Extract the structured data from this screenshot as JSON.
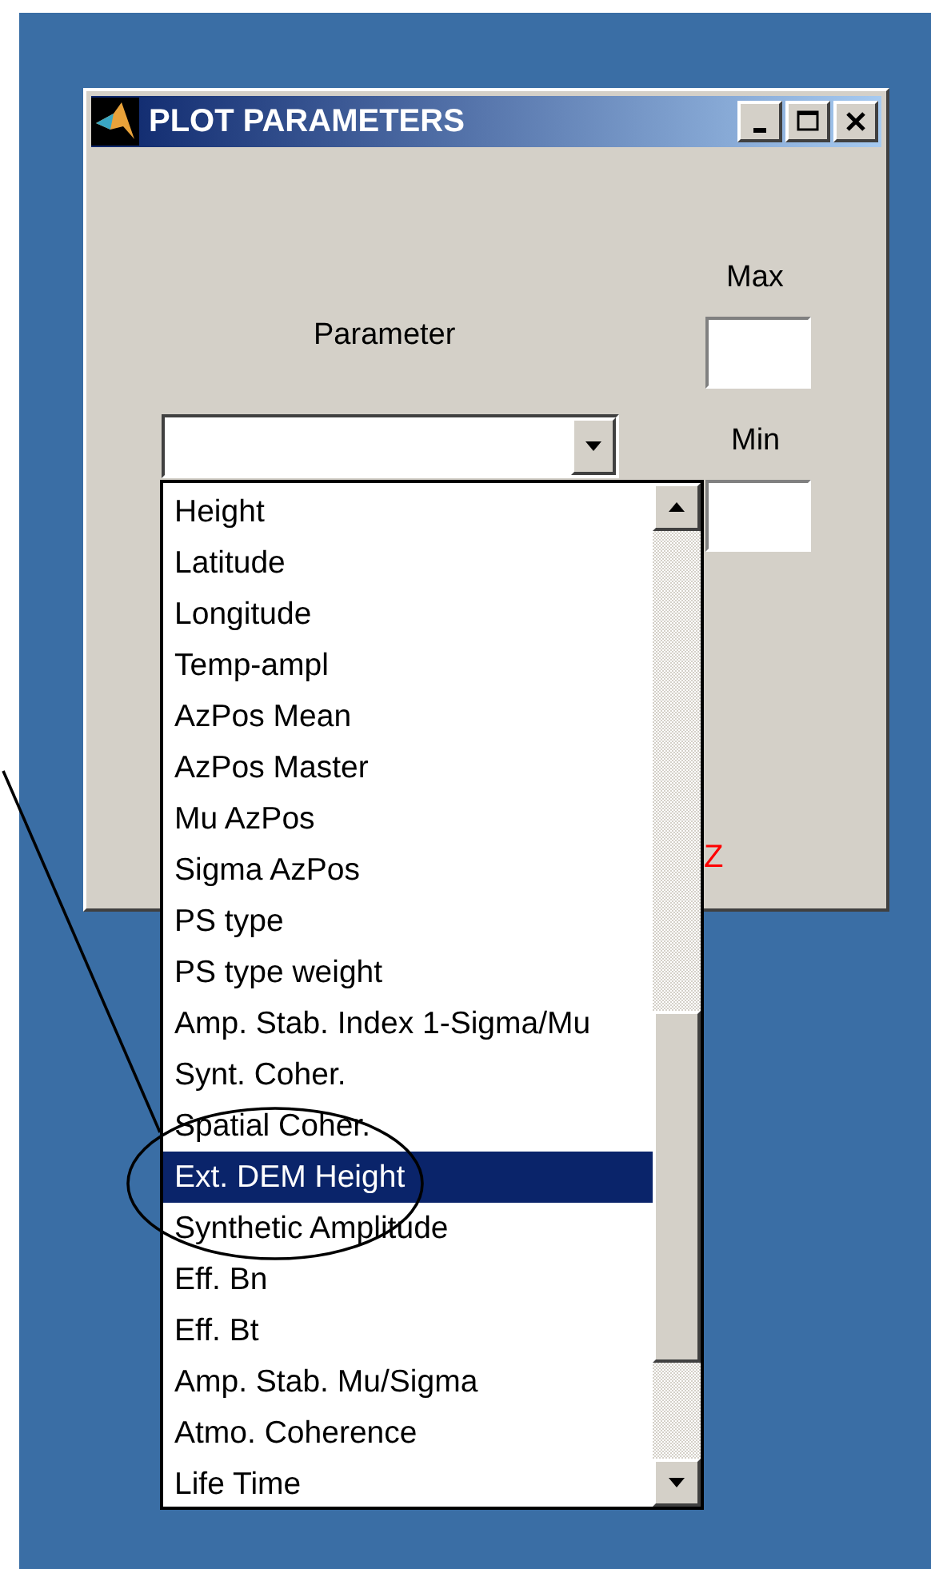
{
  "window": {
    "title": "PLOT PARAMETERS"
  },
  "parameter_label": "Parameter",
  "max_label": "Max",
  "min_label": "Min",
  "partial_label": "Z",
  "dropdown": {
    "items": [
      {
        "label": "Height",
        "selected": false
      },
      {
        "label": "Latitude",
        "selected": false
      },
      {
        "label": "Longitude",
        "selected": false
      },
      {
        "label": "Temp-ampl",
        "selected": false
      },
      {
        "label": "AzPos Mean",
        "selected": false
      },
      {
        "label": "AzPos Master",
        "selected": false
      },
      {
        "label": "Mu AzPos",
        "selected": false
      },
      {
        "label": "Sigma AzPos",
        "selected": false
      },
      {
        "label": "PS type",
        "selected": false
      },
      {
        "label": "PS type weight",
        "selected": false
      },
      {
        "label": "Amp. Stab. Index 1-Sigma/Mu",
        "selected": false
      },
      {
        "label": "Synt. Coher.",
        "selected": false
      },
      {
        "label": "Spatial Coher.",
        "selected": false
      },
      {
        "label": "Ext. DEM Height",
        "selected": true
      },
      {
        "label": "Synthetic Amplitude",
        "selected": false
      },
      {
        "label": "Eff. Bn",
        "selected": false
      },
      {
        "label": "Eff. Bt",
        "selected": false
      },
      {
        "label": "Amp. Stab. Mu/Sigma",
        "selected": false
      },
      {
        "label": "Atmo. Coherence",
        "selected": false
      },
      {
        "label": "Life Time",
        "selected": false
      }
    ]
  }
}
